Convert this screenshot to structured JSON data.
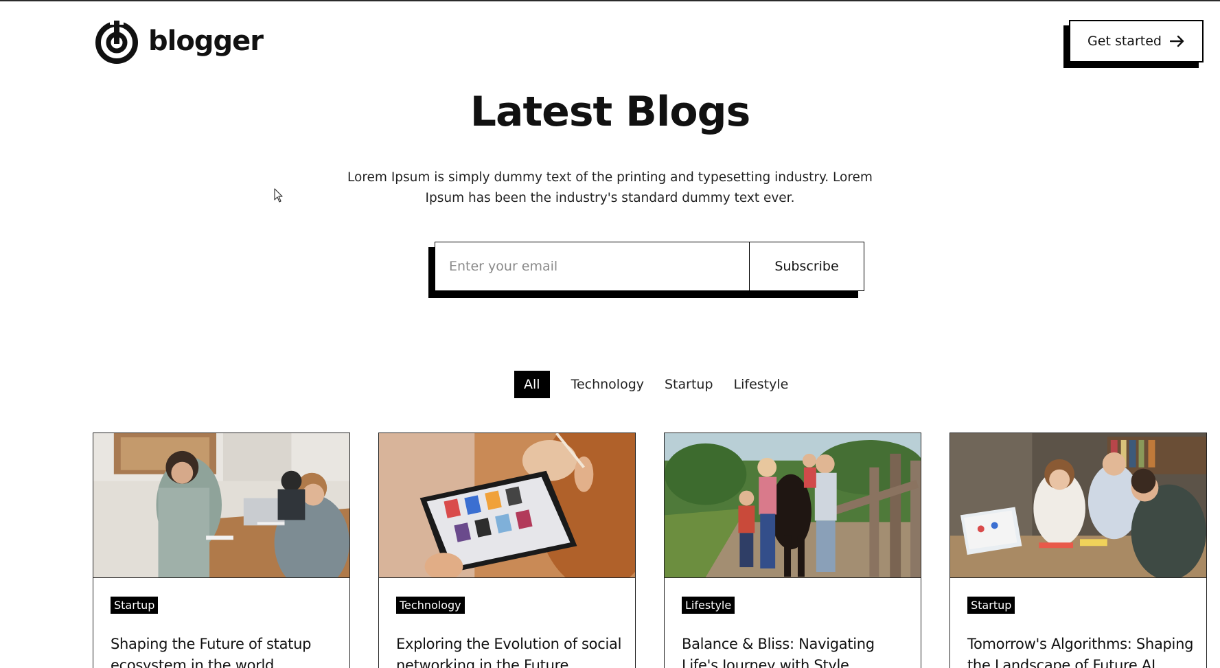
{
  "brand": {
    "name": "blogger"
  },
  "header": {
    "cta_label": "Get started",
    "cta_icon": "arrow-right-icon"
  },
  "hero": {
    "title": "Latest Blogs",
    "subtitle": "Lorem Ipsum is simply dummy text of the printing and typesetting industry. Lorem Ipsum has been the industry's standard dummy text ever."
  },
  "subscribe": {
    "placeholder": "Enter your email",
    "value": "",
    "button_label": "Subscribe"
  },
  "filters": {
    "active": "All",
    "items": [
      "All",
      "Technology",
      "Startup",
      "Lifestyle"
    ]
  },
  "cards": [
    {
      "tag": "Startup",
      "title": "Shaping the Future of statup ecosystem in the world"
    },
    {
      "tag": "Technology",
      "title": "Exploring the Evolution of social networking in the Future"
    },
    {
      "tag": "Lifestyle",
      "title": "Balance & Bliss: Navigating Life's Journey with Style"
    },
    {
      "tag": "Startup",
      "title": "Tomorrow's Algorithms: Shaping the Landscape of Future AI"
    }
  ],
  "colors": {
    "accent": "#000000",
    "background": "#ffffff",
    "text": "#111111"
  }
}
